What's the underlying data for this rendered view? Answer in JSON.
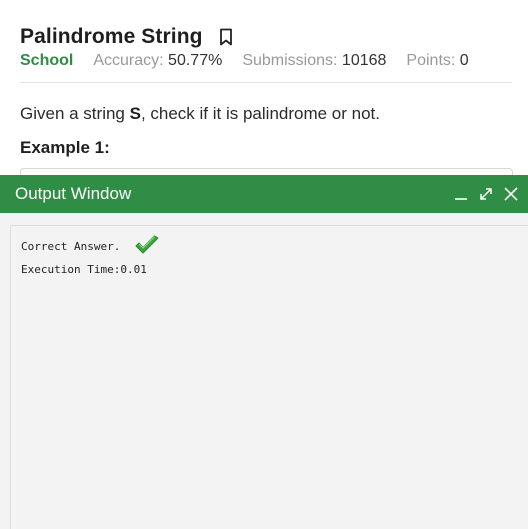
{
  "problem": {
    "title": "Palindrome String",
    "bookmark_icon": "bookmark-icon",
    "difficulty": "School",
    "accuracy_label": "Accuracy:",
    "accuracy_value": "50.77%",
    "submissions_label": "Submissions:",
    "submissions_value": "10168",
    "points_label": "Points:",
    "points_value": "0",
    "description_before": "Given a string ",
    "description_bold": "S",
    "description_after": ", check if it is palindrome or not.",
    "example_heading": "Example 1:"
  },
  "output_window": {
    "title": "Output Window",
    "controls": [
      "minimize-icon",
      "expand-icon",
      "close-icon"
    ],
    "result_text": "Correct Answer.",
    "result_icon": "checkmark-icon",
    "execution_text": "Execution Time:0.01"
  },
  "colors": {
    "brand_green": "#2f8d46",
    "check_green": "#3aa53a"
  }
}
